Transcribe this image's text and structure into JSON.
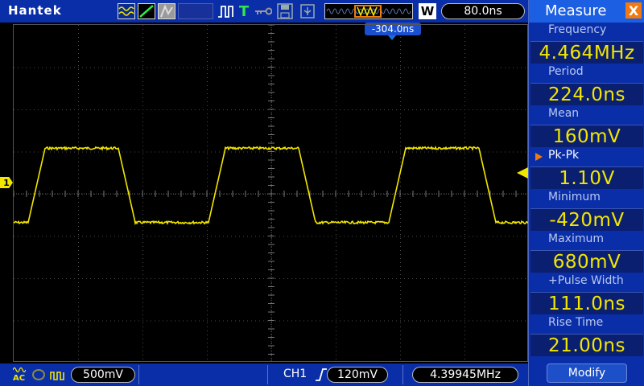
{
  "brand": "Hantek",
  "toolbar": {
    "run_stop_icon": "run-icon",
    "trigger_icon": "T",
    "memory_window_icon": "memory-depth-icon",
    "zoom_label": "W",
    "timebase": "80.0ns",
    "trigger_position": "-304.0ns"
  },
  "channel": {
    "marker": "1",
    "coupling": "AC",
    "volts_per_div": "500mV",
    "trigger_source": "CH1",
    "trigger_level": "120mV",
    "counter_frequency": "4.39945MHz"
  },
  "measure": {
    "title": "Measure",
    "close": "X",
    "items": [
      {
        "label": "Frequency",
        "value": "4.464MHz"
      },
      {
        "label": "Period",
        "value": "224.0ns"
      },
      {
        "label": "Mean",
        "value": "160mV"
      },
      {
        "label": "Pk-Pk",
        "value": "1.10V"
      },
      {
        "label": "Minimum",
        "value": "-420mV"
      },
      {
        "label": "Maximum",
        "value": "680mV"
      },
      {
        "label": "+Pulse Width",
        "value": "111.0ns"
      },
      {
        "label": "Rise Time",
        "value": "21.00ns"
      }
    ],
    "selected_index": 3,
    "modify": "Modify"
  },
  "colors": {
    "chrome": "#0a2ea8",
    "trace": "#f2e600",
    "accent": "#f07a10",
    "highlight": "#1d5fe3"
  },
  "waveform": {
    "channel": "CH1",
    "shape": "square",
    "period_ns": 224.0,
    "high_mV": 540,
    "low_mV": -340,
    "rise_time_ns": 21.0,
    "time_per_div_ns": 80.0,
    "volts_per_div_mV": 500,
    "ground_offset_mV": 0
  }
}
